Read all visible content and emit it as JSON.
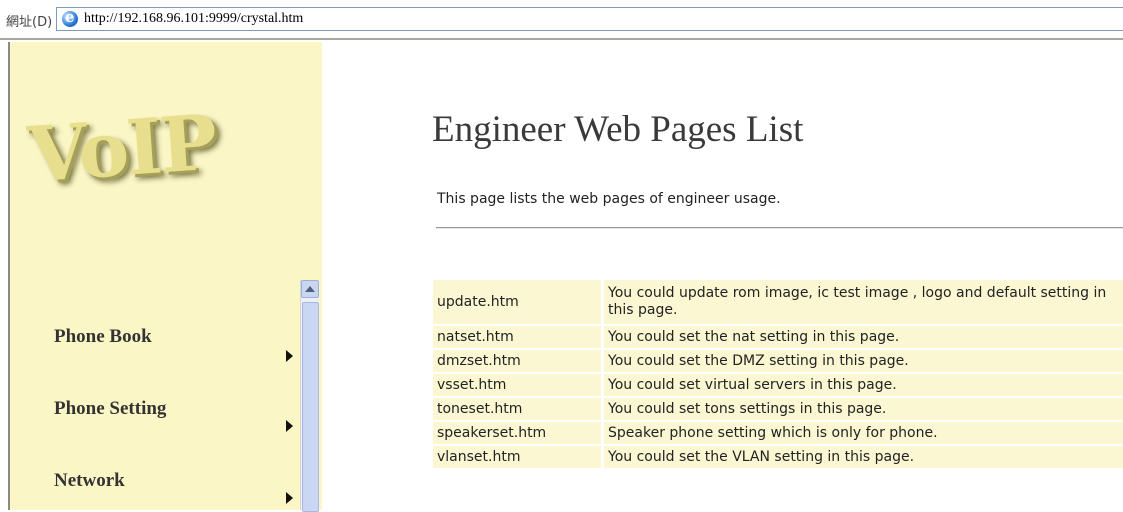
{
  "browser": {
    "address_label": "網址(D)",
    "url": "http://192.168.96.101:9999/crystal.htm"
  },
  "sidebar": {
    "logo_text": "VoIP",
    "menu": [
      {
        "label": "Phone Book"
      },
      {
        "label": "Phone Setting"
      },
      {
        "label": "Network"
      }
    ]
  },
  "main": {
    "title": "Engineer Web Pages List",
    "description": "This page lists the web pages of engineer usage.",
    "rows": [
      {
        "page": "update.htm",
        "desc": "You could update rom image, ic test image , logo and default setting in this page."
      },
      {
        "page": "natset.htm",
        "desc": "You could set the nat setting in this page."
      },
      {
        "page": "dmzset.htm",
        "desc": "You could set the DMZ setting in this page."
      },
      {
        "page": "vsset.htm",
        "desc": "You could set virtual servers in this page."
      },
      {
        "page": "toneset.htm",
        "desc": "You could set tons settings in this page."
      },
      {
        "page": "speakerset.htm",
        "desc": "Speaker phone setting which is only for phone."
      },
      {
        "page": "vlanset.htm",
        "desc": "You could set the VLAN setting in this page."
      }
    ]
  },
  "colors": {
    "sidebar_bg": "#fbf6c6",
    "row_bg": "#fbf7d3"
  }
}
